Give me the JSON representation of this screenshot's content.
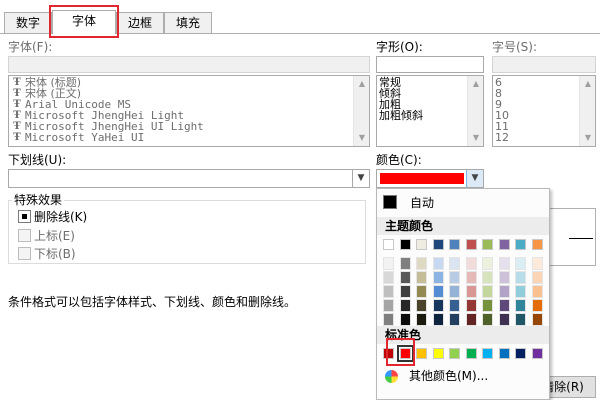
{
  "tabs": [
    {
      "label": "数字",
      "active": false
    },
    {
      "label": "字体",
      "active": true
    },
    {
      "label": "边框",
      "active": false
    },
    {
      "label": "填充",
      "active": false
    }
  ],
  "font": {
    "label": "字体(F):",
    "items": [
      "宋体 (标题)",
      "宋体 (正文)",
      "Arial Unicode MS",
      "Microsoft JhengHei Light",
      "Microsoft JhengHei UI Light",
      "Microsoft YaHei UI"
    ],
    "icon_glyph": "Ŧ"
  },
  "style": {
    "label": "字形(O):",
    "items": [
      "常规",
      "倾斜",
      "加粗",
      "加粗倾斜"
    ]
  },
  "size": {
    "label": "字号(S):",
    "items": [
      "6",
      "8",
      "9",
      "10",
      "11",
      "12"
    ]
  },
  "underline": {
    "label": "下划线(U):"
  },
  "color": {
    "label": "颜色(C):",
    "selected_hex": "#ff0000"
  },
  "effects": {
    "legend": "特殊效果",
    "strikethrough": "删除线(K)",
    "superscript": "上标(E)",
    "subscript": "下标(B)"
  },
  "description": "条件格式可以包括字体样式、下划线、颜色和删除线。",
  "color_popup": {
    "automatic_label": "自动",
    "theme_header": "主题颜色",
    "theme_top_row": [
      "#ffffff",
      "#000000",
      "#eeece1",
      "#1f497d",
      "#4f81bd",
      "#c0504d",
      "#9bbb59",
      "#8064a2",
      "#4bacc6",
      "#f79646"
    ],
    "theme_shades": [
      [
        "#f2f2f2",
        "#7f7f7f",
        "#ddd9c3",
        "#c6d9f0",
        "#dbe5f1",
        "#f2dcdb",
        "#ebf1dd",
        "#e5e0ec",
        "#dbeef3",
        "#fdeada"
      ],
      [
        "#d8d8d8",
        "#595959",
        "#c4bd97",
        "#8db3e2",
        "#b8cce4",
        "#e5b9b7",
        "#d7e3bc",
        "#ccc1d9",
        "#b7dde8",
        "#fbd5b5"
      ],
      [
        "#bfbfbf",
        "#3f3f3f",
        "#938953",
        "#548dd4",
        "#95b3d7",
        "#d99694",
        "#c3d69b",
        "#b2a2c7",
        "#92cddc",
        "#fac08f"
      ],
      [
        "#a5a5a5",
        "#262626",
        "#494429",
        "#17365d",
        "#366092",
        "#953734",
        "#76923c",
        "#5f497a",
        "#31859b",
        "#e36c09"
      ],
      [
        "#7f7f7f",
        "#0c0c0c",
        "#1d1b10",
        "#0f243e",
        "#244061",
        "#632423",
        "#4f6128",
        "#3f3151",
        "#205867",
        "#974806"
      ]
    ],
    "standard_header": "标准色",
    "standard_colors": [
      "#c00000",
      "#ff0000",
      "#ffc000",
      "#ffff00",
      "#92d050",
      "#00b050",
      "#00b0f0",
      "#0070c0",
      "#002060",
      "#7030a0"
    ],
    "more_colors_label": "其他颜色(M)...",
    "selected_standard": "#ff0000"
  },
  "clear_button": {
    "label": "清除(R)",
    "visible_text": "清除(R)"
  },
  "accent_highlight": "#e0262f"
}
